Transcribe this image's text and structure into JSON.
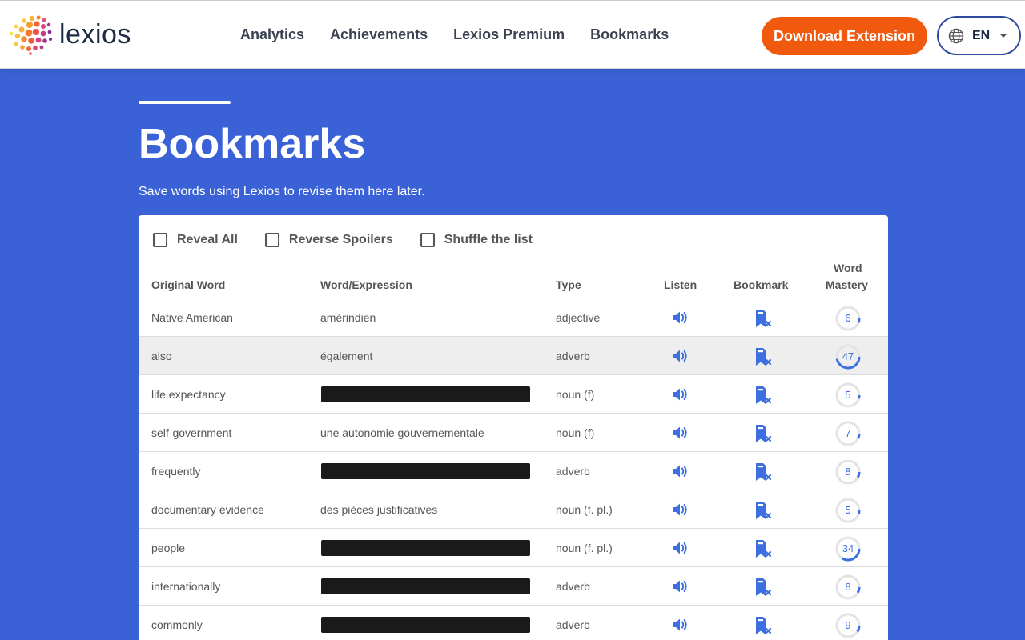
{
  "brand": {
    "name": "lexios"
  },
  "nav": [
    "Analytics",
    "Achievements",
    "Lexios Premium",
    "Bookmarks"
  ],
  "actions": {
    "download_label": "Download Extension",
    "language": "EN"
  },
  "page": {
    "title": "Bookmarks",
    "subtitle": "Save words using Lexios to revise them here later."
  },
  "options": [
    {
      "label": "Reveal All",
      "checked": false
    },
    {
      "label": "Reverse Spoilers",
      "checked": false
    },
    {
      "label": "Shuffle the list",
      "checked": false
    }
  ],
  "columns": {
    "original": "Original Word",
    "word": "Word/Expression",
    "type": "Type",
    "listen": "Listen",
    "bookmark": "Bookmark",
    "mastery_1": "Word",
    "mastery_2": "Mastery"
  },
  "rows": [
    {
      "original": "Native American",
      "word": "amérindien",
      "hidden": false,
      "type": "adjective",
      "mastery": 6
    },
    {
      "original": "also",
      "word": "également",
      "hidden": false,
      "type": "adverb",
      "mastery": 47
    },
    {
      "original": "life expectancy",
      "word": "",
      "hidden": true,
      "type": "noun (f)",
      "mastery": 5
    },
    {
      "original": "self-government",
      "word": "une autonomie gouvernementale",
      "hidden": false,
      "type": "noun (f)",
      "mastery": 7
    },
    {
      "original": "frequently",
      "word": "",
      "hidden": true,
      "type": "adverb",
      "mastery": 8
    },
    {
      "original": "documentary evidence",
      "word": "des pièces justificatives",
      "hidden": false,
      "type": "noun (f. pl.)",
      "mastery": 5
    },
    {
      "original": "people",
      "word": "",
      "hidden": true,
      "type": "noun (f. pl.)",
      "mastery": 34
    },
    {
      "original": "internationally",
      "word": "",
      "hidden": true,
      "type": "adverb",
      "mastery": 8
    },
    {
      "original": "commonly",
      "word": "",
      "hidden": true,
      "type": "adverb",
      "mastery": 9
    }
  ],
  "highlighted_row": 1,
  "icons": {
    "globe": "globe-icon",
    "listen": "speaker-icon",
    "bookmark": "bookmark-remove-icon",
    "caret": "chevron-down-icon"
  },
  "colors": {
    "brand_orange": "#f15a0e",
    "hero_blue": "#3a62d6",
    "icon_blue": "#3d6fe0",
    "hidden_bar": "#1a1a1a"
  }
}
